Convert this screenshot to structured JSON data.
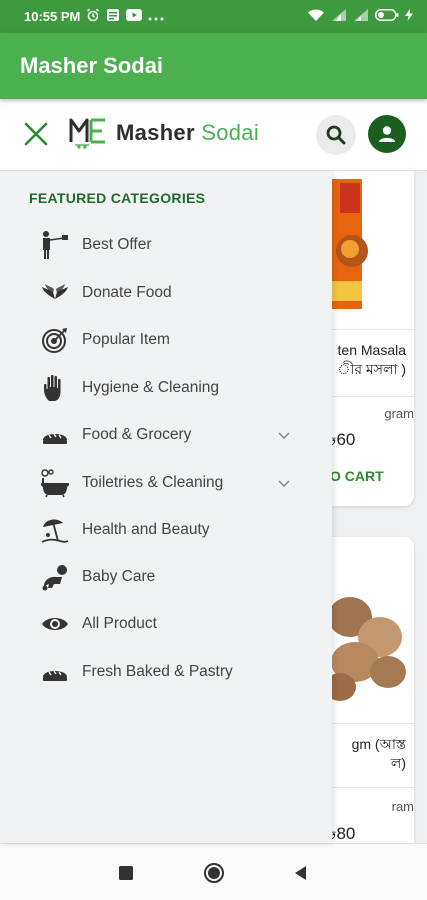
{
  "status_bar": {
    "time": "10:55 PM",
    "icons_left": [
      "alarm-icon",
      "app-icon",
      "youtube-icon",
      "more-icon"
    ],
    "icons_right": [
      "wifi-icon",
      "signal-icon",
      "signal-2-icon",
      "battery-icon",
      "charging-icon"
    ]
  },
  "app_bar": {
    "title": "Masher Sodai"
  },
  "header": {
    "logo_main": "Masher ",
    "logo_accent": "Sodai"
  },
  "drawer": {
    "heading": "FEATURED CATEGORIES",
    "items": [
      {
        "label": "Best Offer",
        "icon": "offer-icon",
        "expandable": false
      },
      {
        "label": "Donate Food",
        "icon": "wings-icon",
        "expandable": false
      },
      {
        "label": "Popular Item",
        "icon": "target-icon",
        "expandable": false
      },
      {
        "label": "Hygiene & Cleaning",
        "icon": "hand-icon",
        "expandable": false
      },
      {
        "label": "Food & Grocery",
        "icon": "bread-icon",
        "expandable": true
      },
      {
        "label": "Toiletries & Cleaning",
        "icon": "bathtub-icon",
        "expandable": true
      },
      {
        "label": "Health and Beauty",
        "icon": "beach-icon",
        "expandable": false
      },
      {
        "label": "Baby Care",
        "icon": "baby-icon",
        "expandable": false
      },
      {
        "label": "All Product",
        "icon": "eye-icon",
        "expandable": false
      },
      {
        "label": "Fresh Baked & Pastry",
        "icon": "bread-icon",
        "expandable": false
      }
    ]
  },
  "products": [
    {
      "title_line1": "ten Masala",
      "title_line2": "ীর মসলা )",
      "unit": "gram",
      "price": "৳60",
      "cart_label": "O CART"
    },
    {
      "title_line1": "gm (আস্ত",
      "title_line2": "ল)",
      "unit": "ram",
      "price": "৳80"
    }
  ],
  "colors": {
    "primary": "#4caf50",
    "status": "#3d9a3f",
    "dark_green": "#1b5e20",
    "heading_green": "#1e6b2a"
  }
}
